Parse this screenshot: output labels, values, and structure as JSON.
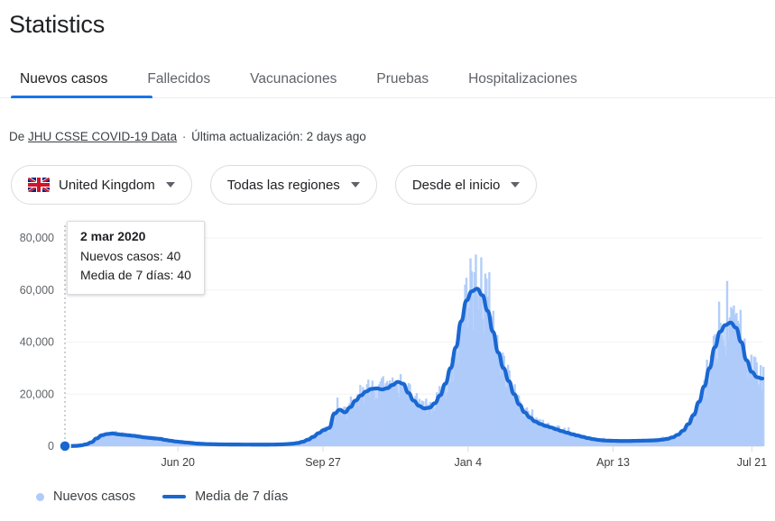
{
  "header": {
    "title": "Statistics"
  },
  "tabs": [
    {
      "label": "Nuevos casos",
      "active": true
    },
    {
      "label": "Fallecidos",
      "active": false
    },
    {
      "label": "Vacunaciones",
      "active": false
    },
    {
      "label": "Pruebas",
      "active": false
    },
    {
      "label": "Hospitalizaciones",
      "active": false
    }
  ],
  "source": {
    "prefix": "De",
    "link": "JHU CSSE COVID-19 Data",
    "separator": "·",
    "updated": "Última actualización: 2 days ago"
  },
  "filters": [
    {
      "name": "country",
      "label": "United Kingdom",
      "icon": "uk-flag-icon"
    },
    {
      "name": "region",
      "label": "Todas las regiones",
      "icon": null
    },
    {
      "name": "period",
      "label": "Desde el inicio",
      "icon": null
    }
  ],
  "tooltip": {
    "date": "2 mar 2020",
    "row1": "Nuevos casos: 40",
    "row2": "Media de 7 días: 40"
  },
  "legend": [
    {
      "label": "Nuevos casos",
      "marker": "dot",
      "color": "#aecbfa"
    },
    {
      "label": "Media de 7 días",
      "marker": "line",
      "color": "#1967d2"
    }
  ],
  "colors": {
    "accent": "#1a73e8",
    "line": "#1967d2",
    "fill": "#aecbfa",
    "grid": "#f1f3f4",
    "text": "#202124",
    "muted": "#5f6368",
    "border": "#dadce0"
  },
  "chart_data": {
    "type": "area",
    "title": "",
    "xlabel": "",
    "ylabel": "",
    "ylim": [
      0,
      80000
    ],
    "grid": true,
    "legend_position": "bottom-left",
    "y_ticks": [
      0,
      20000,
      40000,
      60000,
      80000
    ],
    "y_tick_labels": [
      "0",
      "20,000",
      "40,000",
      "60,000",
      "80,000"
    ],
    "x_tick_labels": [
      "Jun 20",
      "Sep 27",
      "Jan 4",
      "Apr 13",
      "Jul 21"
    ],
    "x_tick_positions": [
      0.162,
      0.37,
      0.578,
      0.786,
      0.985
    ],
    "x_range_start": "2 mar 2020",
    "x_range_end": "Jul 21 2021",
    "highlight": {
      "x_fraction": 0.0,
      "date": "2 mar 2020",
      "new_cases": 40,
      "avg7": 40
    },
    "series": [
      {
        "name": "Nuevos casos",
        "type": "bar-noise",
        "color": "#aecbfa",
        "note": "daily bars, noisy around the 7-day average"
      },
      {
        "name": "Media de 7 días",
        "type": "line",
        "color": "#1967d2",
        "values": [
          40,
          60,
          120,
          300,
          700,
          1500,
          3000,
          4200,
          4700,
          4900,
          4600,
          4400,
          4200,
          4000,
          3700,
          3400,
          3200,
          3000,
          2800,
          2400,
          2100,
          1800,
          1600,
          1400,
          1200,
          1000,
          900,
          800,
          750,
          700,
          680,
          660,
          650,
          640,
          630,
          620,
          610,
          600,
          600,
          620,
          650,
          700,
          800,
          950,
          1200,
          1700,
          2500,
          3600,
          5000,
          6200,
          7000,
          12500,
          14000,
          13000,
          15000,
          17500,
          19500,
          21000,
          22000,
          22200,
          21800,
          22300,
          23500,
          24700,
          24000,
          20500,
          17500,
          15500,
          14500,
          14800,
          16500,
          19500,
          24000,
          30000,
          38000,
          48000,
          56000,
          59500,
          60500,
          58000,
          52000,
          44000,
          36000,
          30000,
          25000,
          20000,
          16000,
          13000,
          11000,
          9500,
          8500,
          7800,
          7200,
          6500,
          5800,
          5200,
          4600,
          4100,
          3600,
          3100,
          2700,
          2400,
          2200,
          2100,
          2050,
          2000,
          1980,
          2000,
          2050,
          2100,
          2150,
          2200,
          2300,
          2500,
          2800,
          3400,
          4400,
          6000,
          8500,
          12000,
          17000,
          23000,
          30000,
          38000,
          44000,
          46500,
          47500,
          45500,
          40000,
          33000,
          28500,
          26500,
          26000
        ]
      }
    ]
  }
}
